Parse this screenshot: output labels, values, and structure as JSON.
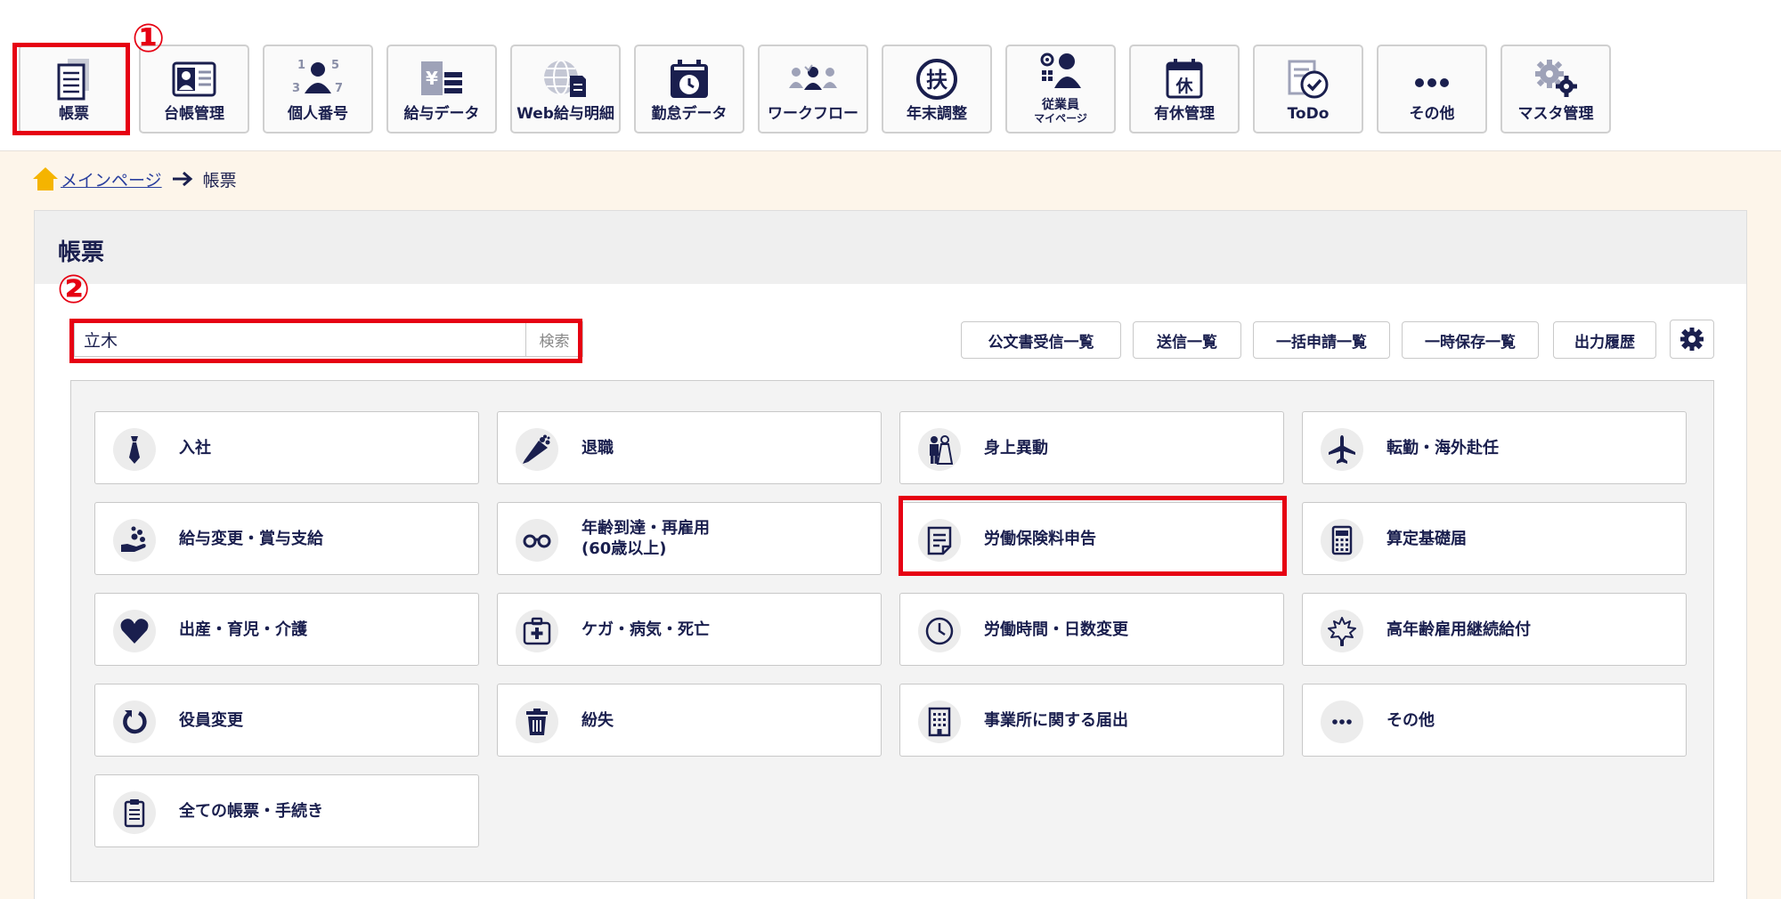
{
  "toolbar": {
    "items": [
      {
        "label": "帳票",
        "icon": "document-list-icon"
      },
      {
        "label": "台帳管理",
        "icon": "id-card-icon"
      },
      {
        "label": "個人番号",
        "icon": "person-number-icon"
      },
      {
        "label": "給与データ",
        "icon": "yen-data-icon"
      },
      {
        "label": "Web給与明細",
        "icon": "globe-document-icon"
      },
      {
        "label": "勤怠データ",
        "icon": "clock-calendar-icon"
      },
      {
        "label": "ワークフロー",
        "icon": "workflow-people-icon"
      },
      {
        "label": "年末調整",
        "icon": "fuyou-seal-icon"
      },
      {
        "label": "従業員",
        "sublabel": "マイページ",
        "icon": "employee-mypage-icon"
      },
      {
        "label": "有休管理",
        "icon": "calendar-kyu-icon"
      },
      {
        "label": "ToDo",
        "icon": "todo-check-icon"
      },
      {
        "label": "その他",
        "icon": "more-dots-icon"
      },
      {
        "label": "マスタ管理",
        "icon": "gears-icon"
      }
    ]
  },
  "callouts": {
    "one": "①",
    "two": "②"
  },
  "breadcrumb": {
    "home_link": "メインページ",
    "current": "帳票"
  },
  "panel": {
    "title": "帳票"
  },
  "search": {
    "value": "立木",
    "button_label": "検索"
  },
  "actions": {
    "items": [
      {
        "label": "公文書受信一覧"
      },
      {
        "label": "送信一覧"
      },
      {
        "label": "一括申請一覧"
      },
      {
        "label": "一時保存一覧"
      },
      {
        "label": "出力履歴"
      }
    ],
    "settings_icon": "gear-icon"
  },
  "categories": [
    {
      "label": "入社",
      "icon": "necktie-icon"
    },
    {
      "label": "退職",
      "icon": "bouquet-icon"
    },
    {
      "label": "身上異動",
      "icon": "wedding-couple-icon"
    },
    {
      "label": "転勤・海外赴任",
      "icon": "airplane-icon"
    },
    {
      "label": "給与変更・賞与支給",
      "icon": "hand-coins-icon"
    },
    {
      "label": "年齢到達・再雇用\n(60歳以上)",
      "icon": "glasses-icon"
    },
    {
      "label": "労働保険料申告",
      "icon": "document-form-icon"
    },
    {
      "label": "算定基礎届",
      "icon": "calculator-icon"
    },
    {
      "label": "出産・育児・介護",
      "icon": "heart-icon"
    },
    {
      "label": "ケガ・病気・死亡",
      "icon": "first-aid-kit-icon"
    },
    {
      "label": "労働時間・日数変更",
      "icon": "clock-icon"
    },
    {
      "label": "高年齢雇用継続給付",
      "icon": "maple-leaf-icon"
    },
    {
      "label": "役員変更",
      "icon": "refresh-icon"
    },
    {
      "label": "紛失",
      "icon": "trash-icon"
    },
    {
      "label": "事業所に関する届出",
      "icon": "office-building-icon"
    },
    {
      "label": "その他",
      "icon": "more-dots-icon"
    },
    {
      "label": "全ての帳票・手続き",
      "icon": "clipboard-list-icon"
    }
  ],
  "colors": {
    "navy": "#1a1f4e",
    "highlight_red": "#e60012",
    "background_beige": "#fdf5ea",
    "link_blue": "#2a3f9e",
    "home_icon": "#f5b400"
  }
}
